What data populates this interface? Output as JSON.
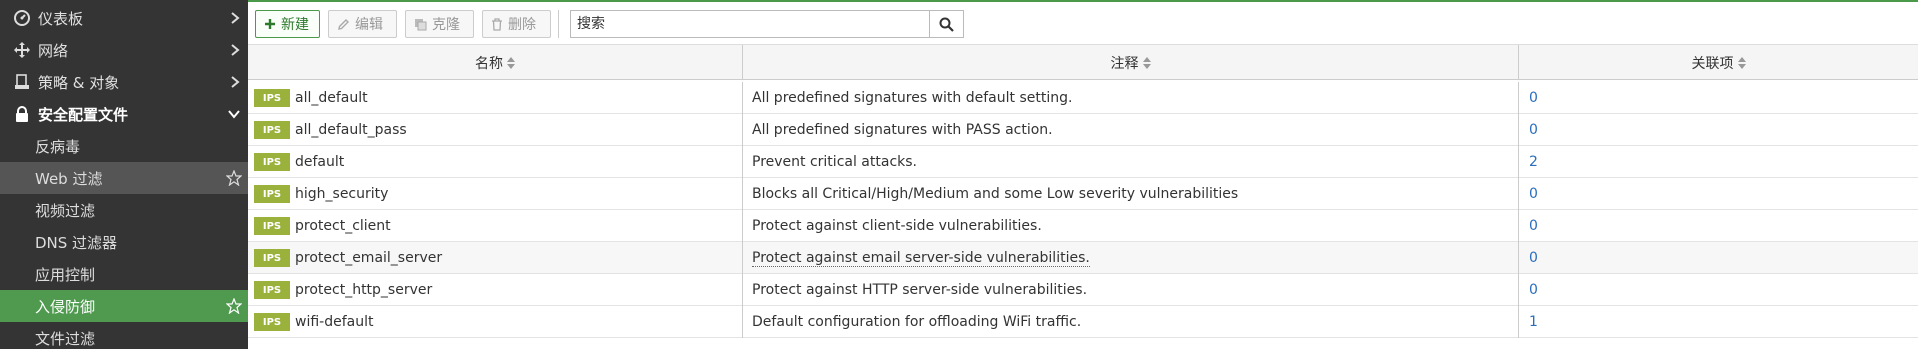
{
  "sidebar": {
    "items": [
      {
        "label": "仪表板",
        "icon": "dashboard-icon"
      },
      {
        "label": "网络",
        "icon": "network-move-icon"
      },
      {
        "label": "策略 & 对象",
        "icon": "policy-doc-icon"
      },
      {
        "label": "安全配置文件",
        "icon": "lock-icon"
      }
    ],
    "subitems": [
      {
        "label": "反病毒"
      },
      {
        "label": "Web 过滤"
      },
      {
        "label": "视频过滤"
      },
      {
        "label": "DNS 过滤器"
      },
      {
        "label": "应用控制"
      },
      {
        "label": "入侵防御"
      },
      {
        "label": "文件过滤"
      }
    ]
  },
  "toolbar": {
    "new_label": "新建",
    "edit_label": "编辑",
    "clone_label": "克隆",
    "delete_label": "删除",
    "search_placeholder": "搜索"
  },
  "table": {
    "headers": {
      "name": "名称",
      "comment": "注释",
      "refs": "关联项"
    },
    "badge": "IPS",
    "rows": [
      {
        "name": "all_default",
        "comment": "All predefined signatures with default setting.",
        "refs": "0"
      },
      {
        "name": "all_default_pass",
        "comment": "All predefined signatures with PASS action.",
        "refs": "0"
      },
      {
        "name": "default",
        "comment": "Prevent critical attacks.",
        "refs": "2"
      },
      {
        "name": "high_security",
        "comment": "Blocks all Critical/High/Medium and some Low severity vulnerabilities",
        "refs": "0"
      },
      {
        "name": "protect_client",
        "comment": "Protect against client-side vulnerabilities.",
        "refs": "0"
      },
      {
        "name": "protect_email_server",
        "comment": "Protect against email server-side vulnerabilities.",
        "refs": "0"
      },
      {
        "name": "protect_http_server",
        "comment": "Protect against HTTP server-side vulnerabilities.",
        "refs": "0"
      },
      {
        "name": "wifi-default",
        "comment": "Default configuration for offloading WiFi traffic.",
        "refs": "1"
      }
    ]
  },
  "colors": {
    "accent": "#4f9a4f",
    "sidebar_bg": "#343434",
    "badge": "#9ab23c",
    "link": "#2a6ebb"
  }
}
